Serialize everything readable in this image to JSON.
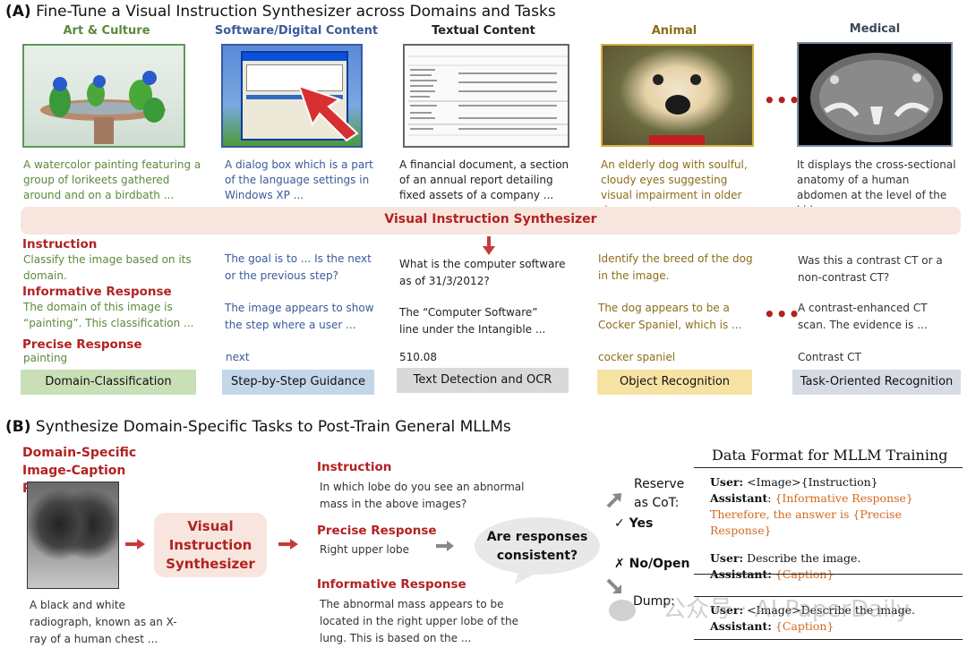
{
  "partA": {
    "tag": "(A)",
    "title": "Fine-Tune a Visual Instruction Synthesizer across Domains and Tasks",
    "domains": [
      {
        "name": "Art & Culture",
        "color": "#5a8a3a",
        "caption": "A watercolor painting featuring a group of lorikeets gathered around and on a birdbath ...",
        "instruction": "Classify the image based on its domain.",
        "informative": "The domain of this image is “painting”. This classification ...",
        "precise": "painting",
        "task": "Domain-Classification",
        "task_bg": "#c9dfb6"
      },
      {
        "name": "Software/Digital Content",
        "color": "#3a5a9a",
        "caption": "A dialog box which is a part of the language settings in Windows XP ...",
        "instruction": "The goal is to ... Is the next or the previous step?",
        "informative": "The image appears to show the step where a user ...",
        "precise": "next",
        "task": "Step-by-Step Guidance",
        "task_bg": "#c3d6ea"
      },
      {
        "name": "Textual Content",
        "color": "#222222",
        "caption": "A financial document, a section of an annual report detailing fixed assets of a company ...",
        "instruction": "What is the computer software as of 31/3/2012?",
        "informative": "The “Computer Software” line under the Intangible ...",
        "precise": "510.08",
        "task": "Text Detection and OCR",
        "task_bg": "#d9d9d9"
      },
      {
        "name": "Animal",
        "color": "#8a6d1a",
        "caption": "An elderly dog with soulful, cloudy eyes suggesting visual impairment in older dogs ...",
        "instruction": "Identify the breed of the dog in the image.",
        "informative": "The dog appears to be a Cocker Spaniel, which is ...",
        "precise": "cocker spaniel",
        "task": "Object Recognition",
        "task_bg": "#f6e3a3"
      },
      {
        "name": "Medical",
        "color": "#3a4a5a",
        "caption": "It displays the cross-sectional anatomy of a human abdomen at the level of the kidneys ...",
        "instruction": "Was this a contrast CT or a non-contrast CT?",
        "informative": "A contrast-enhanced CT scan. The evidence is ...",
        "precise": "Contrast CT",
        "task": "Task-Oriented Recognition",
        "task_bg": "#d6dbe4"
      }
    ],
    "synth_bar": "Visual Instruction Synthesizer",
    "labels": {
      "instruction": "Instruction",
      "informative": "Informative Response",
      "precise": "Precise Response"
    },
    "ellipsis": "•••"
  },
  "partB": {
    "tag": "(B)",
    "title": "Synthesize Domain-Specific Tasks to Post-Train General MLLMs",
    "pair_label": "Domain-Specific Image-Caption Pair",
    "caption": "A black and white radiograph, known as an X-ray of a human chest ...",
    "synth_box": "Visual Instruction Synthesizer",
    "instruction_label": "Instruction",
    "instruction": "In which lobe do you see an abnormal mass in the above images?",
    "precise_label": "Precise Response",
    "precise": "Right upper lobe",
    "informative_label": "Informative Response",
    "informative": "The abnormal mass appears to be located in the right upper lobe of the lung. This is based on the ...",
    "bubble": "Are responses consistent?",
    "reserve": "Reserve as CoT:",
    "yes": "✓ Yes",
    "no": "✗ No/Open",
    "dump": "Dump:",
    "format_title": "Data Format for MLLM Training",
    "format_reserve": {
      "u1_k": "User:",
      "u1_v": " <Image>{Instruction}",
      "a1_k": "Assistant",
      "a1_v": ": ",
      "a1_o": "{Informative Response}",
      "a1_o2": "Therefore, the answer is {Precise Response}",
      "u2_k": "User:",
      "u2_v": " Describe the image.",
      "a2_k": "Assistant:",
      "a2_o": " {Caption}"
    },
    "format_dump": {
      "u_k": "User:",
      "u_v": " <Image>Describe the image.",
      "a_k": "Assistant:",
      "a_o": " {Caption}"
    },
    "watermark": "公众号 · AI PaperDaily"
  }
}
